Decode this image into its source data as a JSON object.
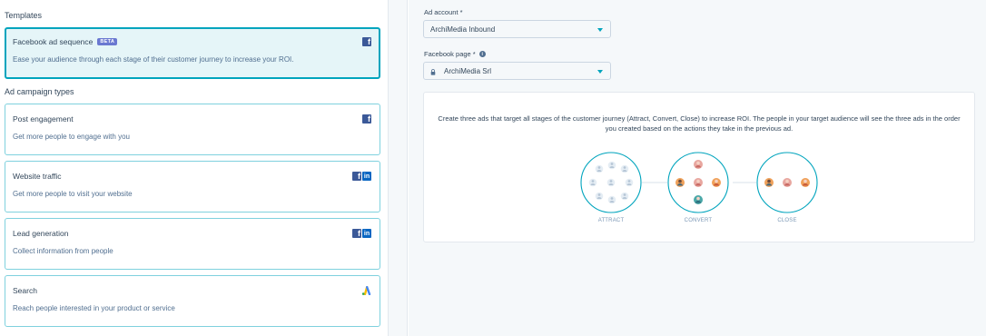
{
  "left": {
    "templates_heading": "Templates",
    "template_card": {
      "title": "Facebook ad sequence",
      "badge": "BETA",
      "description": "Ease your audience through each stage of their customer journey to increase your ROI.",
      "icons": [
        "facebook-icon"
      ]
    },
    "campaign_types_heading": "Ad campaign types",
    "cards": [
      {
        "title": "Post engagement",
        "description": "Get more people to engage with you",
        "icons": [
          "facebook-icon"
        ]
      },
      {
        "title": "Website traffic",
        "description": "Get more people to visit your website",
        "icons": [
          "facebook-icon",
          "linkedin-icon"
        ]
      },
      {
        "title": "Lead generation",
        "description": "Collect information from people",
        "icons": [
          "facebook-icon",
          "linkedin-icon"
        ]
      },
      {
        "title": "Search",
        "description": "Reach people interested in your product or service",
        "icons": [
          "google-ads-icon"
        ]
      }
    ]
  },
  "right": {
    "ad_account": {
      "label": "Ad account *",
      "value": "ArchiMedia Inbound"
    },
    "facebook_page": {
      "label": "Facebook page *",
      "value": "ArchiMedia Srl",
      "info_icon": "info-icon",
      "lock_icon": "lock-icon"
    },
    "info_text": "Create three ads that target all stages of the customer journey (Attract, Convert, Close) to increase ROI. The people in your target audience will see the three ads in the order you created based on the actions they take in the previous ad.",
    "stages": [
      {
        "label": "ATTRACT"
      },
      {
        "label": "CONVERT"
      },
      {
        "label": "CLOSE"
      }
    ]
  },
  "colors": {
    "accent": "#00a4bd",
    "card_border": "#7fd1de",
    "selected_bg": "#e5f5f8",
    "facebook": "#3b5998",
    "linkedin": "#0a66c2",
    "badge": "#6a78d1"
  }
}
